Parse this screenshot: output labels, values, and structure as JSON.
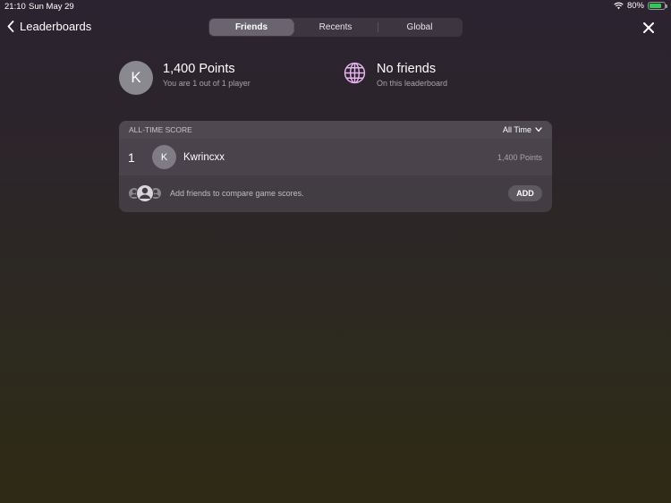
{
  "status_bar": {
    "time": "21:10",
    "date": "Sun May 29",
    "battery": "80%",
    "battery_level": 0.8
  },
  "nav": {
    "back_label": "Leaderboards"
  },
  "tabs": [
    {
      "label": "Friends",
      "active": true
    },
    {
      "label": "Recents",
      "active": false
    },
    {
      "label": "Global",
      "active": false
    }
  ],
  "summary": {
    "avatar_initial": "K",
    "points": "1,400 Points",
    "rank_text": "You are 1 out of 1 player",
    "friends_title": "No friends",
    "friends_sub": "On this leaderboard"
  },
  "leaderboard": {
    "header": "ALL-TIME SCORE",
    "filter": "All Time",
    "rows": [
      {
        "rank": "1",
        "initial": "K",
        "name": "Kwrincxx",
        "score": "1,400 Points"
      }
    ],
    "add_friends_text": "Add friends to compare game scores.",
    "add_label": "ADD"
  },
  "colors": {
    "accent_green": "#35c759",
    "globe": "#e8b4f0"
  }
}
